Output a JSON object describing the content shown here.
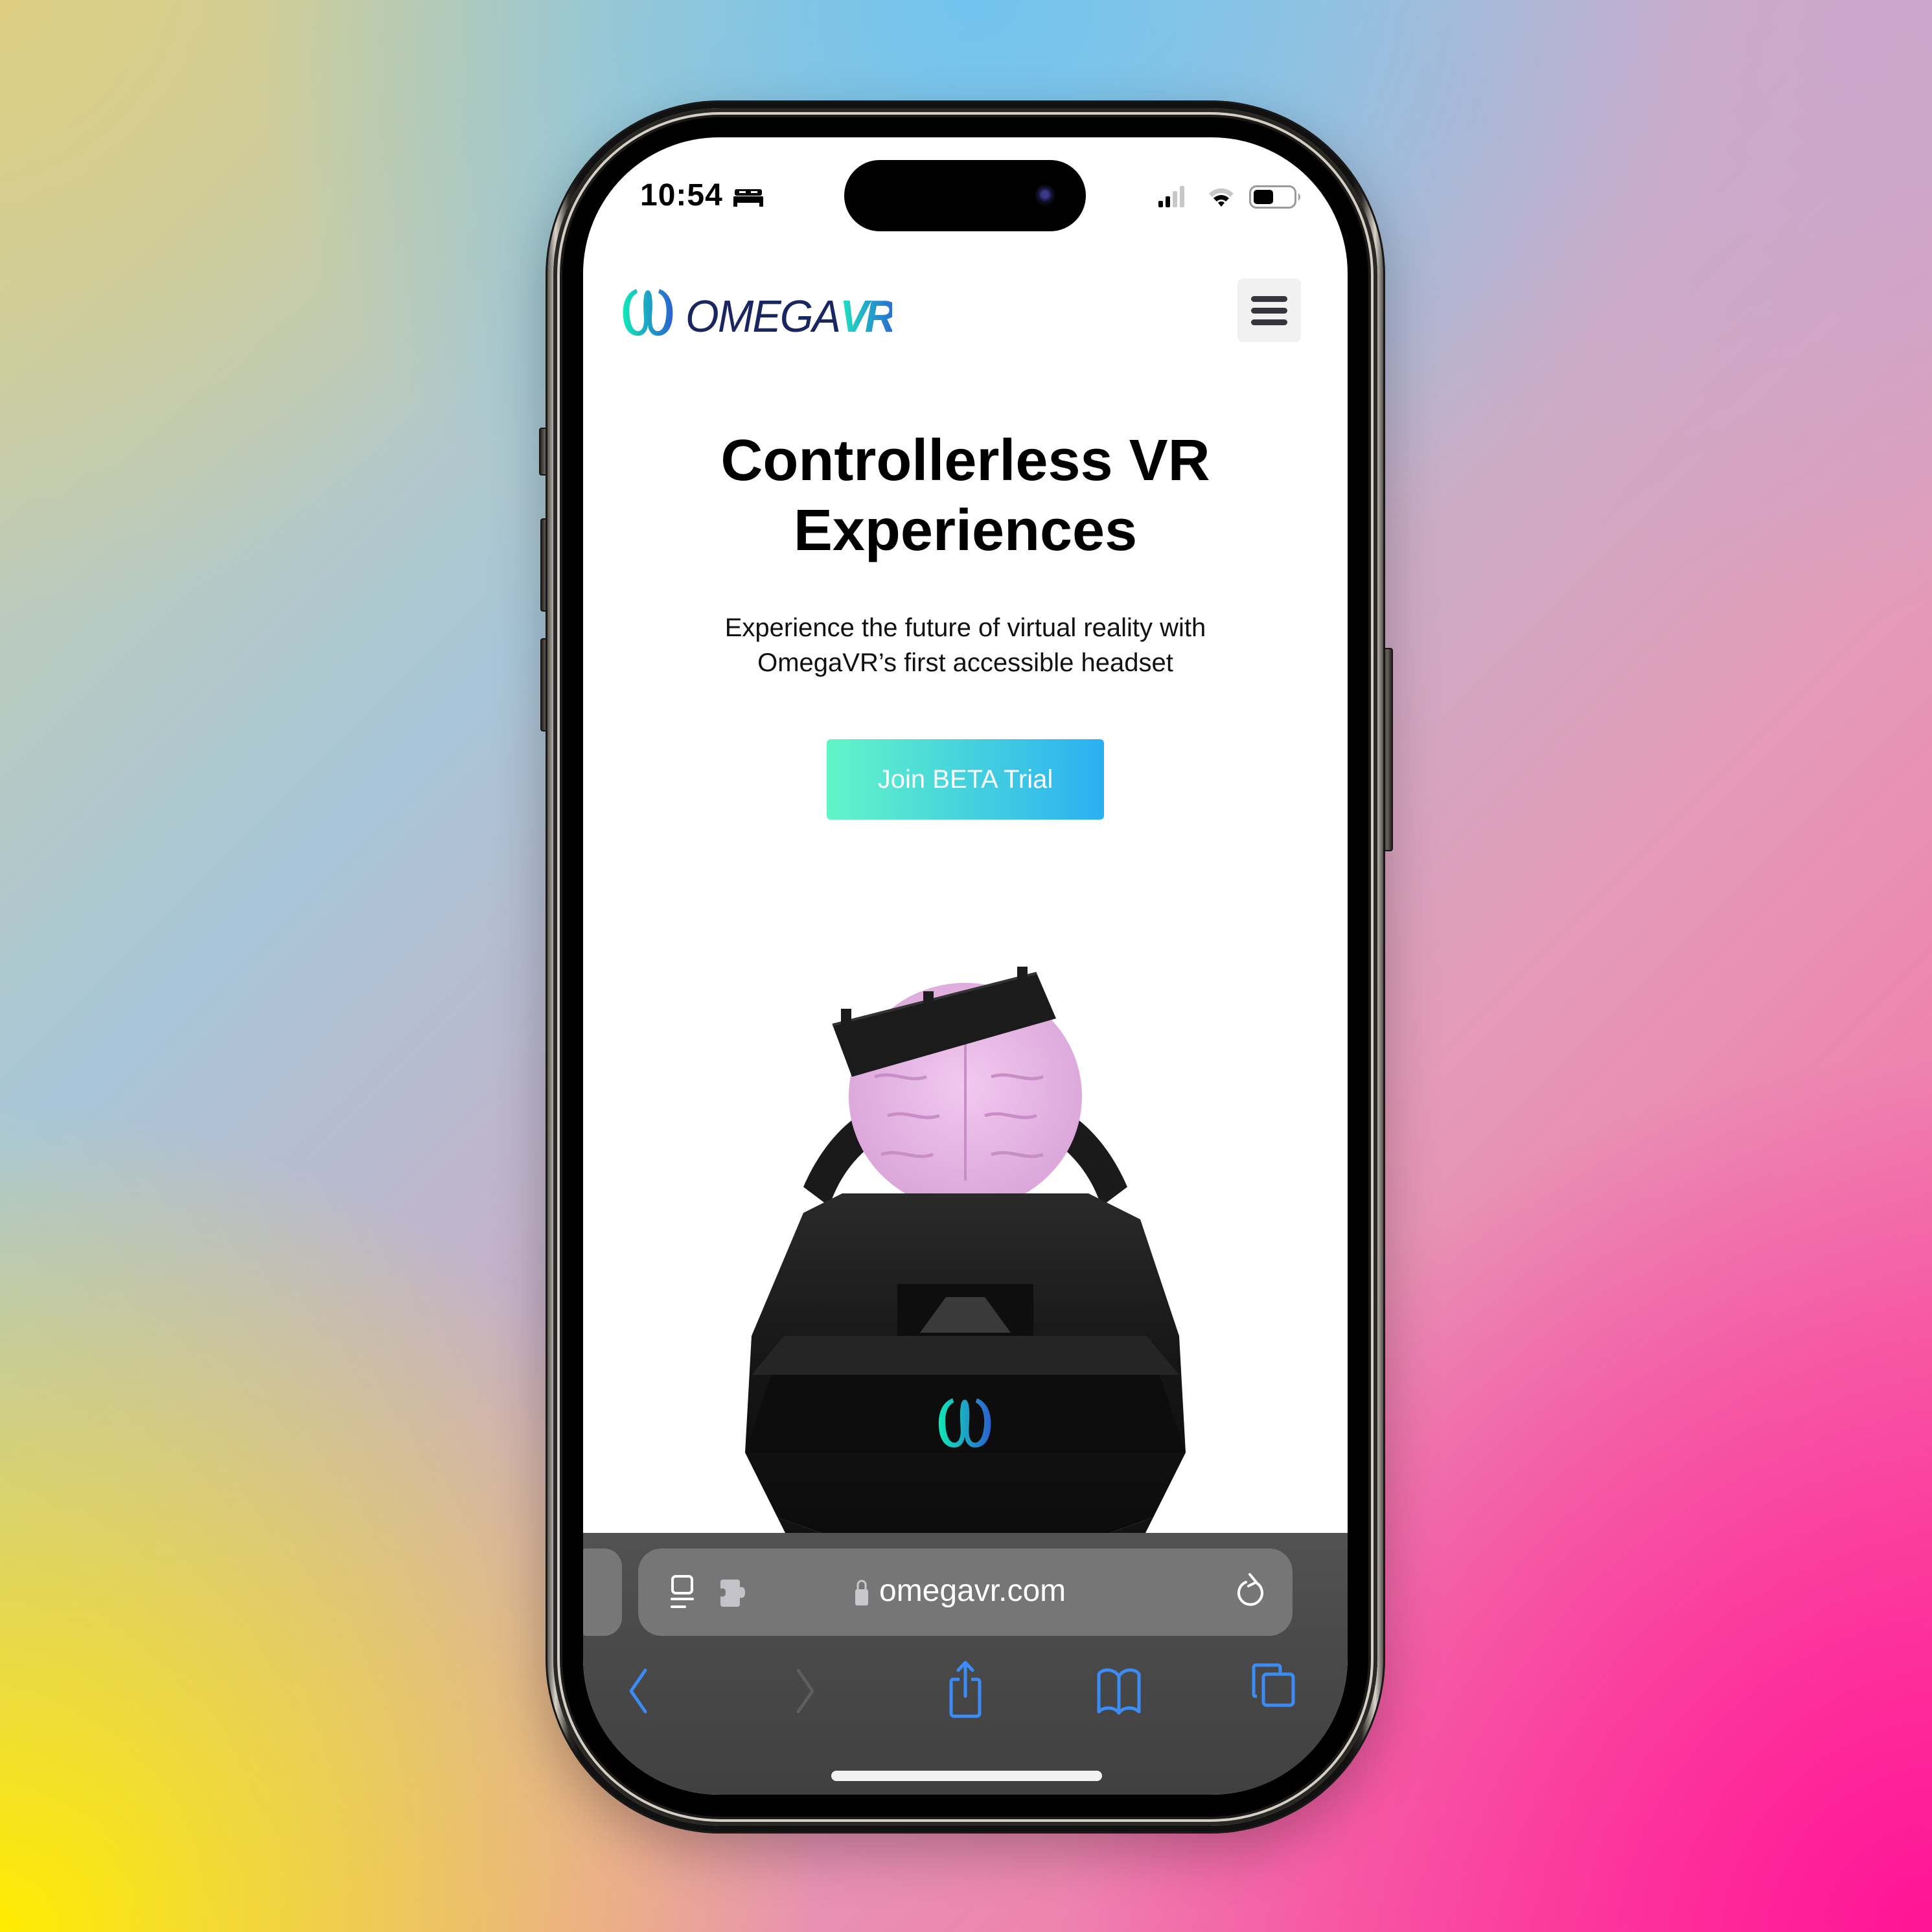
{
  "status_bar": {
    "time": "10:54",
    "focus_mode_icon": "bed-icon",
    "signal_icon": "cellular-signal-icon",
    "wifi_icon": "wifi-icon",
    "battery_icon": "battery-icon"
  },
  "site_header": {
    "logo_text": "OMEGA",
    "logo_accent": "VR",
    "logo_icon": "omega-logo-icon",
    "menu_icon": "hamburger-menu-icon"
  },
  "hero": {
    "title_line1": "Controllerless VR",
    "title_line2": "Experiences",
    "subtitle_line1": "Experience the future of virtual reality with",
    "subtitle_line2": "OmegaVR’s first accessible headset",
    "cta_label": "Join BETA Trial",
    "image_alt": "OmegaVR headset with brain model"
  },
  "browser": {
    "url": "omegavr.com",
    "page_menu_icon": "page-format-icon",
    "extension_icon": "extension-puzzle-icon",
    "lock_icon": "lock-icon",
    "reload_icon": "reload-icon",
    "toolbar": [
      {
        "name": "back",
        "icon": "chevron-left-icon",
        "enabled": true
      },
      {
        "name": "forward",
        "icon": "chevron-right-icon",
        "enabled": false
      },
      {
        "name": "share",
        "icon": "share-icon",
        "enabled": true
      },
      {
        "name": "bookmarks",
        "icon": "book-icon",
        "enabled": true
      },
      {
        "name": "tabs",
        "icon": "tabs-icon",
        "enabled": true
      }
    ]
  },
  "colors": {
    "brand_navy": "#1a2660",
    "brand_teal": "#1de6c0",
    "brand_blue": "#2a6fd0",
    "cta_start": "#62f5c8",
    "cta_end": "#2ab0f2",
    "safari_blue": "#3b8cf5",
    "toolbar_bg": "#4a4a4a"
  }
}
